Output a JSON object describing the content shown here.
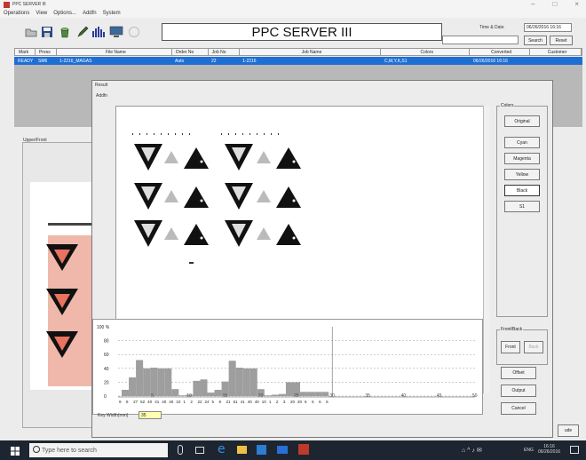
{
  "window": {
    "title": "PPC SERVER III",
    "controls": [
      "–",
      "□",
      "×"
    ]
  },
  "menu": [
    "Operations",
    "View",
    "Options...",
    "Addfn",
    "System"
  ],
  "toolbar": {
    "server_title": "PPC SERVER III",
    "time_date_label": "Time & Date",
    "time_date_value": "06/26/2016 16:16",
    "search_label": "Search",
    "reset_label": "Reset"
  },
  "table": {
    "headers": [
      "Mark",
      "Press",
      "File Name",
      "Order No",
      "Job No",
      "Job Name",
      "Colors",
      "Converted",
      "Customer"
    ],
    "row": [
      "READY",
      "SM6",
      "1-2216_MAGAS",
      "Auto",
      "22",
      "1-2216",
      "C,M,Y,K,S1",
      "06/26/2016 16:16",
      ""
    ]
  },
  "upper_panel_label": "Upper/Front",
  "dialog": {
    "title": "Result",
    "menu": "Addfn",
    "colors_group": "Colors",
    "color_buttons": [
      "Original",
      "Cyan",
      "Magenta",
      "Yellow",
      "Black",
      "S1"
    ],
    "front_back_group": "Front/Back",
    "front_label": "Front",
    "back_label": "Back",
    "offset_label": "Offset",
    "output_label": "Output",
    "cancel_label": "Cancel",
    "key_width_label": "Key Width(mm)",
    "key_width_value": "35"
  },
  "chart_data": {
    "type": "bar",
    "ylabel": "100 %",
    "yticks": [
      0,
      20,
      40,
      60,
      80
    ],
    "xticks": [
      5,
      10,
      15,
      20,
      25,
      30,
      35,
      40,
      45,
      50
    ],
    "ylim": [
      0,
      100
    ],
    "xlim": [
      0,
      50
    ],
    "values": [
      9,
      27,
      52,
      40,
      41,
      40,
      40,
      10,
      1,
      2,
      22,
      24,
      5,
      9,
      21,
      51,
      41,
      40,
      40,
      10,
      1,
      2,
      3,
      20,
      20,
      6,
      6,
      6,
      6
    ],
    "value_row": [
      "9",
      "8",
      "27",
      "52",
      "40",
      "41",
      "40",
      "40",
      "10",
      "1",
      "2",
      "22",
      "24",
      "5",
      "9",
      "21",
      "51",
      "41",
      "40",
      "40",
      "10",
      "1",
      "2",
      "3",
      "20",
      "20",
      "6",
      "6",
      "6",
      "6"
    ]
  },
  "taskbar": {
    "search_placeholder": "Type here to search",
    "clock_time": "16:16",
    "clock_date": "06/26/2016",
    "lang": "ENG"
  },
  "right_partial_button": "ude",
  "colors": {
    "selection": "#1e6fd4",
    "taskbar": "#1c2530",
    "histogram_bar": "#9e9e9e"
  }
}
